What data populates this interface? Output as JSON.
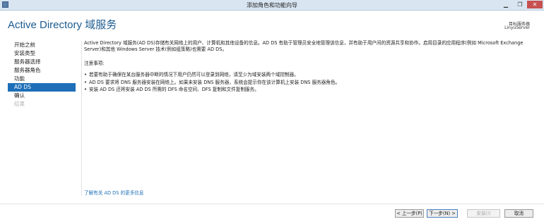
{
  "window": {
    "title": "添加角色和功能向导",
    "controls": {
      "minimize": "▁",
      "maximize": "❐",
      "close": "✕"
    }
  },
  "header": {
    "title": "Active Directory 域服务",
    "target_label": "目标服务器",
    "target_server": "LinyuServer"
  },
  "nav": {
    "items": [
      {
        "label": "开始之前",
        "state": "normal"
      },
      {
        "label": "安装类型",
        "state": "normal"
      },
      {
        "label": "服务器选择",
        "state": "normal"
      },
      {
        "label": "服务器角色",
        "state": "normal"
      },
      {
        "label": "功能",
        "state": "normal"
      },
      {
        "label": "AD DS",
        "state": "active"
      },
      {
        "label": "确认",
        "state": "normal"
      },
      {
        "label": "结果",
        "state": "disabled"
      }
    ]
  },
  "content": {
    "intro": "Active Directory 域服务(AD DS)存储有关网络上的用户、计算机和其他设备的信息。AD DS 有助于管理员安全地管理该信息，并有助于用户间的资源共享和协作。启用目录的应用程序(例如 Microsoft Exchange Server)和其他 Windows Server 技术(例如组策略)也需要 AD DS。",
    "notes_heading": "注意事项:",
    "notes": [
      "若要有助于确保在某台服务器中断的情况下用户仍然可以登录到网络，请至少为域安装两个域控制器。",
      "AD DS 要求将 DNS 服务器安装在网络上。如果未安装 DNS 服务器，系统会提示你在该计算机上安装 DNS 服务器角色。",
      "安装 AD DS 还将安装 AD DS 所需的 DFS 命名空间、DFS 复制和文件复制服务。"
    ],
    "more_link": "了解有关 AD DS 的更多信息"
  },
  "footer": {
    "prev": "< 上一步(P)",
    "next": "下一步(N) >",
    "install": "安装(I)",
    "cancel": "取消"
  },
  "colors": {
    "accent": "#1e6fb8",
    "title_blue": "#1c5b8f",
    "titlebar": "#d9e6f2",
    "close": "#c75050"
  }
}
